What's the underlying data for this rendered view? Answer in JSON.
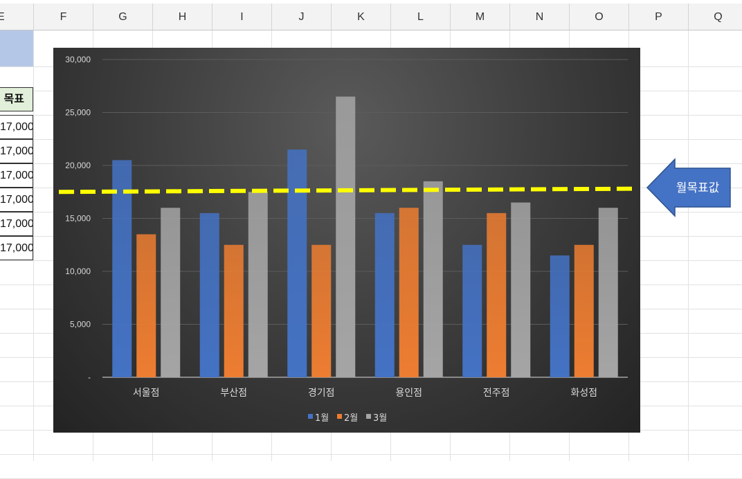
{
  "columns": [
    "E",
    "F",
    "G",
    "H",
    "I",
    "J",
    "K",
    "L",
    "M",
    "N",
    "O",
    "P",
    "Q"
  ],
  "table": {
    "header": "목표",
    "values": [
      "17,000",
      "17,000",
      "17,000",
      "17,000",
      "17,000",
      "17,000"
    ]
  },
  "callout": {
    "label": "월목표값"
  },
  "colors": {
    "series1": "#4472c4",
    "series2": "#ed7d31",
    "series3": "#a5a5a5",
    "target_line": "#ffff00",
    "callout_fill": "#4472c4",
    "header_fill": "#e2efda",
    "selected_cell": "#b4c7e7"
  },
  "chart_data": {
    "type": "bar",
    "categories": [
      "서울점",
      "부산점",
      "경기점",
      "용인점",
      "전주점",
      "화성점"
    ],
    "series": [
      {
        "name": "1월",
        "values": [
          20500,
          15500,
          21500,
          15500,
          12500,
          11500
        ]
      },
      {
        "name": "2월",
        "values": [
          13500,
          12500,
          12500,
          16000,
          15500,
          12500
        ]
      },
      {
        "name": "3월",
        "values": [
          16000,
          17500,
          26500,
          18500,
          16500,
          16000
        ]
      }
    ],
    "ylim": [
      0,
      30000
    ],
    "yticks": [
      {
        "value": 0,
        "label": "-"
      },
      {
        "value": 5000,
        "label": "5,000"
      },
      {
        "value": 10000,
        "label": "10,000"
      },
      {
        "value": 15000,
        "label": "15,000"
      },
      {
        "value": 20000,
        "label": "20,000"
      },
      {
        "value": 25000,
        "label": "25,000"
      },
      {
        "value": 30000,
        "label": "30,000"
      }
    ],
    "target_line": {
      "start": 17500,
      "end": 17800
    },
    "grid": true,
    "legend": "bottom"
  }
}
